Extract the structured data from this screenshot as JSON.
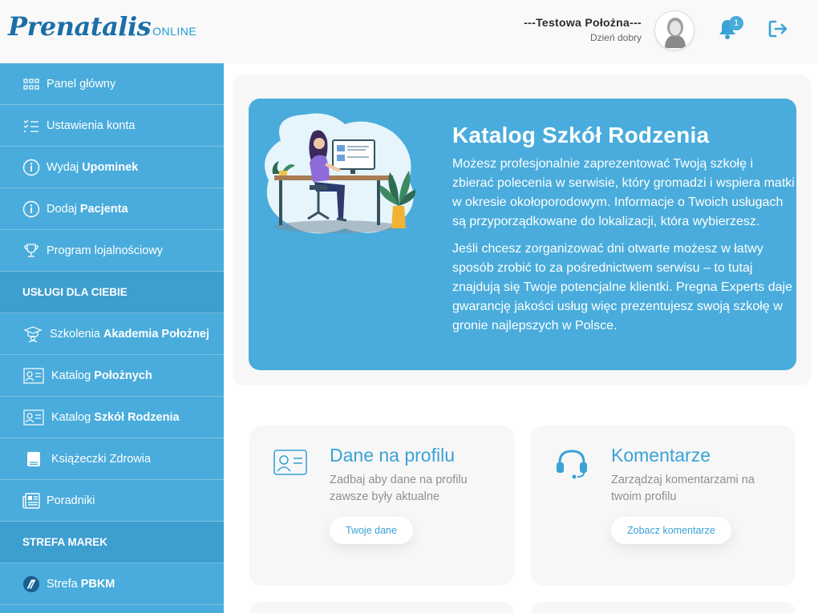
{
  "header": {
    "logo_main": "Prenatalis",
    "logo_sub": "ONLINE",
    "user_name": "---Testowa Położna---",
    "greeting": "Dzień dobry",
    "notifications_count": "1"
  },
  "sidebar": {
    "items": [
      {
        "label": "Panel główny",
        "bold": "",
        "icon": "grid-icon"
      },
      {
        "label": "Ustawienia konta",
        "bold": "",
        "icon": "checklist-icon"
      },
      {
        "label": "Wydaj",
        "bold": "Upominek",
        "icon": "info-icon"
      },
      {
        "label": "Dodaj",
        "bold": "Pacjenta",
        "icon": "info-icon"
      },
      {
        "label": "Program lojalnościowy",
        "bold": "",
        "icon": "trophy-icon"
      }
    ],
    "section1": "USŁUGI DLA CIEBIE",
    "items2": [
      {
        "label": "Szkolenia",
        "bold": "Akademia Położnej",
        "icon": "graduation-icon"
      },
      {
        "label": "Katalog",
        "bold": "Położnych",
        "icon": "id-card-icon"
      },
      {
        "label": "Katalog",
        "bold": "Szkół Rodzenia",
        "icon": "id-card-icon"
      },
      {
        "label": "Książeczki Zdrowia",
        "bold": "",
        "icon": "book-icon"
      },
      {
        "label": "Poradniki",
        "bold": "",
        "icon": "newspaper-icon"
      }
    ],
    "section2": "STREFA MAREK",
    "items3": [
      {
        "label": "Strefa",
        "bold": "PBKM",
        "icon": "pbkm-logo-icon"
      }
    ]
  },
  "hero": {
    "title": "Katalog Szkół Rodzenia",
    "paragraph1": "Możesz profesjonalnie zaprezentować Twoją szkołę i zbierać polecenia w serwisie, który gromadzi i wspiera matki w okresie okołoporodowym. Informacje o Twoich usługach są przyporządkowane do lokalizacji, która wybierzesz.",
    "paragraph2": "Jeśli chcesz zorganizować dni otwarte możesz w łatwy sposób zrobić to za pośrednictwem serwisu – to tutaj znajdują się Twoje potencjalne klientki. Pregna Experts daje gwarancję jakości usług więc prezentujesz swoją szkołę w gronie najlepszych w Polsce."
  },
  "cards": [
    {
      "title": "Dane na profilu",
      "desc": "Zadbaj aby dane na profilu zawsze były aktualne",
      "button": "Twoje dane",
      "icon": "id-card-icon"
    },
    {
      "title": "Komentarze",
      "desc": "Zarządzaj komentarzami na twoim profilu",
      "button": "Zobacz komentarze",
      "icon": "headset-icon"
    }
  ],
  "colors": {
    "accent": "#49acdc",
    "accent_dark": "#3d9ed0",
    "brand": "#1b6fa8"
  }
}
